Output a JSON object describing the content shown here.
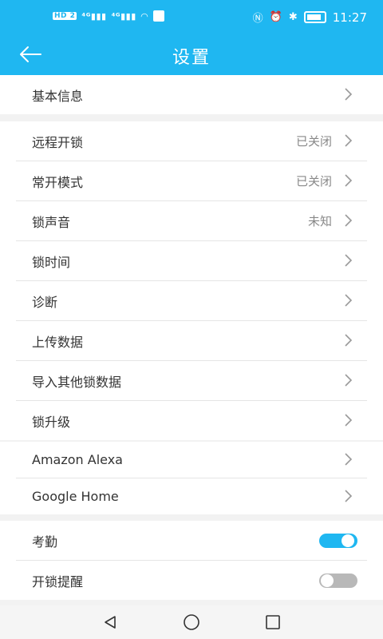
{
  "status_bar": {
    "left": [
      "HD 2",
      "4G",
      "4G",
      "wifi",
      "app"
    ],
    "time": "11:27",
    "icons": [
      "nfc-icon",
      "alarm-icon",
      "bluetooth-icon",
      "battery-icon"
    ]
  },
  "header": {
    "title": "设置",
    "back_icon": "arrow-left-icon"
  },
  "groups": [
    {
      "items": [
        {
          "label": "基本信息",
          "value": ""
        }
      ]
    },
    {
      "items": [
        {
          "label": "远程开锁",
          "value": "已关闭"
        },
        {
          "label": "常开模式",
          "value": "已关闭"
        },
        {
          "label": "锁声音",
          "value": "未知"
        },
        {
          "label": "锁时间",
          "value": ""
        },
        {
          "label": "诊断",
          "value": ""
        },
        {
          "label": "上传数据",
          "value": ""
        },
        {
          "label": "导入其他锁数据",
          "value": ""
        },
        {
          "label": "锁升级",
          "value": ""
        }
      ]
    },
    {
      "items": [
        {
          "label": "Amazon Alexa",
          "value": ""
        },
        {
          "label": "Google Home",
          "value": ""
        }
      ]
    },
    {
      "items": [
        {
          "label": "考勤",
          "toggle": "on"
        },
        {
          "label": "开锁提醒",
          "toggle": "off"
        }
      ]
    }
  ],
  "colors": {
    "accent": "#1fb7f1",
    "background": "#f2f2f2",
    "toggle_off": "#b8b8b8"
  },
  "nav": [
    "back-triangle-icon",
    "home-circle-icon",
    "recents-square-icon"
  ]
}
